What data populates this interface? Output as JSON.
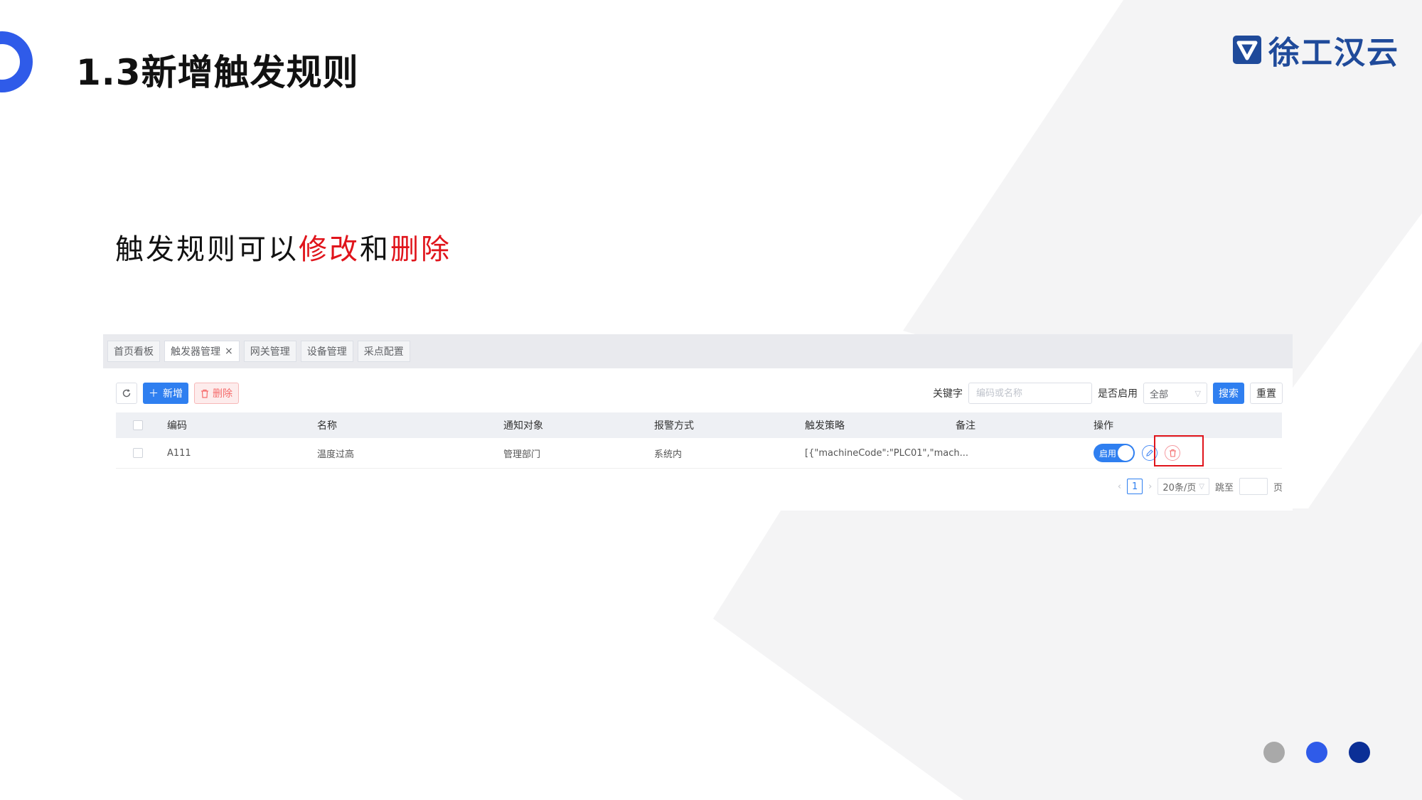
{
  "slide": {
    "title": "1.3新增触发规则",
    "logo_text": "徐工汉云",
    "subtitle_parts": [
      "触发规则可以",
      "修改",
      "和",
      "删除"
    ]
  },
  "colors": {
    "accent_blue": "#2f5be9",
    "highlight_red": "#e0141b",
    "logo_blue": "#1f4a9a",
    "primary_button": "#2f7ff0",
    "dot_grey": "#a9a9a9",
    "dot_blue": "#2f5be9",
    "dot_navy": "#0b2f96"
  },
  "app": {
    "tabs": [
      {
        "label": "首页看板",
        "active": false
      },
      {
        "label": "触发器管理",
        "active": true,
        "closable": true
      },
      {
        "label": "网关管理",
        "active": false
      },
      {
        "label": "设备管理",
        "active": false
      },
      {
        "label": "采点配置",
        "active": false
      }
    ],
    "toolbar": {
      "add_label": "新增",
      "delete_label": "删除"
    },
    "filters": {
      "keyword_label": "关键字",
      "keyword_placeholder": "编码或名称",
      "enabled_label": "是否启用",
      "enabled_value": "全部",
      "search_label": "搜索",
      "reset_label": "重置"
    },
    "table": {
      "columns": [
        "编码",
        "名称",
        "通知对象",
        "报警方式",
        "触发策略",
        "备注",
        "操作"
      ],
      "rows": [
        {
          "code": "A111",
          "name": "温度过高",
          "notify": "管理部门",
          "alarm": "系统内",
          "strategy": "[{\"machineCode\":\"PLC01\",\"mach...",
          "remark": "",
          "switch_label": "启用",
          "enabled": true
        }
      ]
    },
    "pager": {
      "prev": "‹",
      "current": "1",
      "next": "›",
      "page_size": "20条/页",
      "jump_label": "跳至",
      "page_suffix": "页"
    }
  },
  "icons": [
    "refresh-icon",
    "plus-icon",
    "trash-icon",
    "close-icon",
    "chevron-down-icon",
    "edit-icon",
    "delete-icon",
    "logo-mark-icon"
  ]
}
